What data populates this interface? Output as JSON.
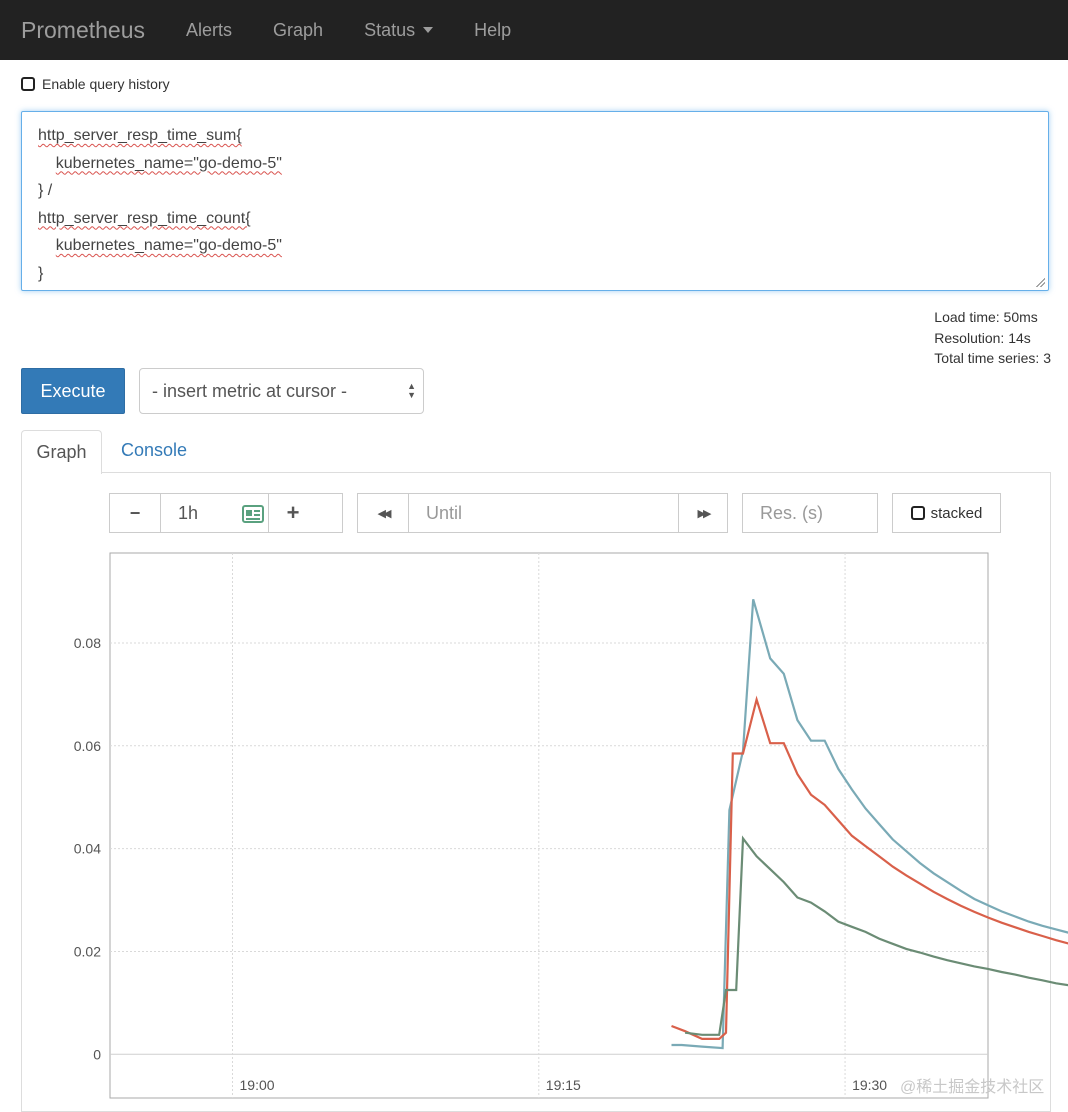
{
  "navbar": {
    "brand": "Prometheus",
    "items": [
      "Alerts",
      "Graph",
      "Status",
      "Help"
    ]
  },
  "query_history_label": "Enable query history",
  "query": {
    "line1": "http_server_resp_time_sum{",
    "line2": "kubernetes_name=\"go-demo-5\"",
    "line3": "} /",
    "line4": "http_server_resp_time_count{",
    "line5": "kubernetes_name=\"go-demo-5\"",
    "line6": "}"
  },
  "stats": {
    "load_time": "Load time: 50ms",
    "resolution": "Resolution: 14s",
    "total_series": "Total time series: 3"
  },
  "execute_label": "Execute",
  "metric_select_label": "- insert metric at cursor -",
  "tabs": {
    "graph": "Graph",
    "console": "Console"
  },
  "controls": {
    "minus": "−",
    "range": "1h",
    "plus": "+",
    "back": "◀◀",
    "until_placeholder": "Until",
    "forward": "▶▶",
    "res_placeholder": "Res. (s)",
    "stacked": "stacked",
    "calendar_icon": "calendar-icon"
  },
  "chart_data": {
    "type": "line",
    "xlabel": "",
    "ylabel": "",
    "grid": true,
    "ylim": [
      -0.0085,
      0.0975
    ],
    "xlim": [
      "18:54",
      "19:37"
    ],
    "yticks": [
      0,
      0.02,
      0.04,
      0.06,
      0.08
    ],
    "ytick_labels": [
      "0",
      "0.02",
      "0.04",
      "0.06",
      "0.08"
    ],
    "xticks": [
      "19:00",
      "19:15",
      "19:30",
      "19:45"
    ],
    "colors": {
      "teal": "#7aaab6",
      "red": "#d9604a",
      "green": "#6b8c75"
    },
    "series": [
      {
        "color": "#7aaab6",
        "points": [
          [
            "19:21:30",
            0.0018
          ],
          [
            "19:22:00",
            0.0018
          ],
          [
            "19:23:00",
            0.0015
          ],
          [
            "19:24:00",
            0.0012
          ],
          [
            "19:24:20",
            0.0475
          ],
          [
            "19:25:00",
            0.059
          ],
          [
            "19:25:30",
            0.0885
          ],
          [
            "19:26:20",
            0.077
          ],
          [
            "19:27:00",
            0.074
          ],
          [
            "19:27:40",
            0.065
          ],
          [
            "19:28:20",
            0.061
          ],
          [
            "19:29:00",
            0.061
          ],
          [
            "19:29:40",
            0.0555
          ],
          [
            "19:30:20",
            0.0515
          ],
          [
            "19:31:00",
            0.0478
          ],
          [
            "19:31:40",
            0.0448
          ],
          [
            "19:32:20",
            0.0418
          ],
          [
            "19:33:00",
            0.0395
          ],
          [
            "19:33:40",
            0.0372
          ],
          [
            "19:34:20",
            0.0352
          ],
          [
            "19:35:00",
            0.0335
          ],
          [
            "19:35:40",
            0.0318
          ],
          [
            "19:36:20",
            0.0302
          ],
          [
            "19:37:00",
            0.029
          ],
          [
            "19:37:40",
            0.0278
          ],
          [
            "19:38:20",
            0.0268
          ],
          [
            "19:39:00",
            0.0258
          ],
          [
            "19:39:40",
            0.025
          ],
          [
            "19:40:20",
            0.0243
          ],
          [
            "19:41:00",
            0.0236
          ],
          [
            "19:41:40",
            0.023
          ],
          [
            "19:42:20",
            0.0224
          ]
        ]
      },
      {
        "color": "#d9604a",
        "points": [
          [
            "19:21:30",
            0.0055
          ],
          [
            "19:22:10",
            0.0045
          ],
          [
            "19:23:00",
            0.003
          ],
          [
            "19:23:50",
            0.003
          ],
          [
            "19:24:10",
            0.0042
          ],
          [
            "19:24:30",
            0.0585
          ],
          [
            "19:25:00",
            0.0585
          ],
          [
            "19:25:40",
            0.069
          ],
          [
            "19:26:20",
            0.0605
          ],
          [
            "19:27:00",
            0.0605
          ],
          [
            "19:27:40",
            0.0545
          ],
          [
            "19:28:20",
            0.0505
          ],
          [
            "19:29:00",
            0.0485
          ],
          [
            "19:29:40",
            0.0455
          ],
          [
            "19:30:20",
            0.0425
          ],
          [
            "19:31:00",
            0.0405
          ],
          [
            "19:31:40",
            0.0385
          ],
          [
            "19:32:20",
            0.0365
          ],
          [
            "19:33:00",
            0.0348
          ],
          [
            "19:33:40",
            0.0332
          ],
          [
            "19:34:20",
            0.0316
          ],
          [
            "19:35:00",
            0.0302
          ],
          [
            "19:35:40",
            0.0289
          ],
          [
            "19:36:20",
            0.0277
          ],
          [
            "19:37:00",
            0.0266
          ],
          [
            "19:37:40",
            0.0256
          ],
          [
            "19:38:20",
            0.0247
          ],
          [
            "19:39:00",
            0.0238
          ],
          [
            "19:39:40",
            0.023
          ],
          [
            "19:40:20",
            0.0222
          ],
          [
            "19:41:00",
            0.0215
          ],
          [
            "19:41:40",
            0.0208
          ],
          [
            "19:42:20",
            0.0201
          ]
        ]
      },
      {
        "color": "#6b8c75",
        "points": [
          [
            "19:22:10",
            0.0042
          ],
          [
            "19:23:00",
            0.0038
          ],
          [
            "19:23:50",
            0.0038
          ],
          [
            "19:24:10",
            0.0125
          ],
          [
            "19:24:40",
            0.0125
          ],
          [
            "19:25:00",
            0.042
          ],
          [
            "19:25:40",
            0.0385
          ],
          [
            "19:26:20",
            0.036
          ],
          [
            "19:27:00",
            0.0335
          ],
          [
            "19:27:40",
            0.0305
          ],
          [
            "19:28:20",
            0.0295
          ],
          [
            "19:29:00",
            0.0278
          ],
          [
            "19:29:40",
            0.0258
          ],
          [
            "19:30:20",
            0.0248
          ],
          [
            "19:31:00",
            0.0238
          ],
          [
            "19:31:40",
            0.0225
          ],
          [
            "19:32:20",
            0.0215
          ],
          [
            "19:33:00",
            0.0205
          ],
          [
            "19:33:40",
            0.0198
          ],
          [
            "19:34:20",
            0.019
          ],
          [
            "19:35:00",
            0.0183
          ],
          [
            "19:35:40",
            0.0177
          ],
          [
            "19:36:20",
            0.0171
          ],
          [
            "19:37:00",
            0.0166
          ],
          [
            "19:37:40",
            0.016
          ],
          [
            "19:38:20",
            0.0155
          ],
          [
            "19:39:00",
            0.0149
          ],
          [
            "19:39:40",
            0.0144
          ],
          [
            "19:40:20",
            0.0138
          ],
          [
            "19:41:00",
            0.0134
          ],
          [
            "19:41:40",
            0.0129
          ],
          [
            "19:42:20",
            0.0124
          ]
        ]
      }
    ]
  },
  "watermark": "@稀土掘金技术社区"
}
